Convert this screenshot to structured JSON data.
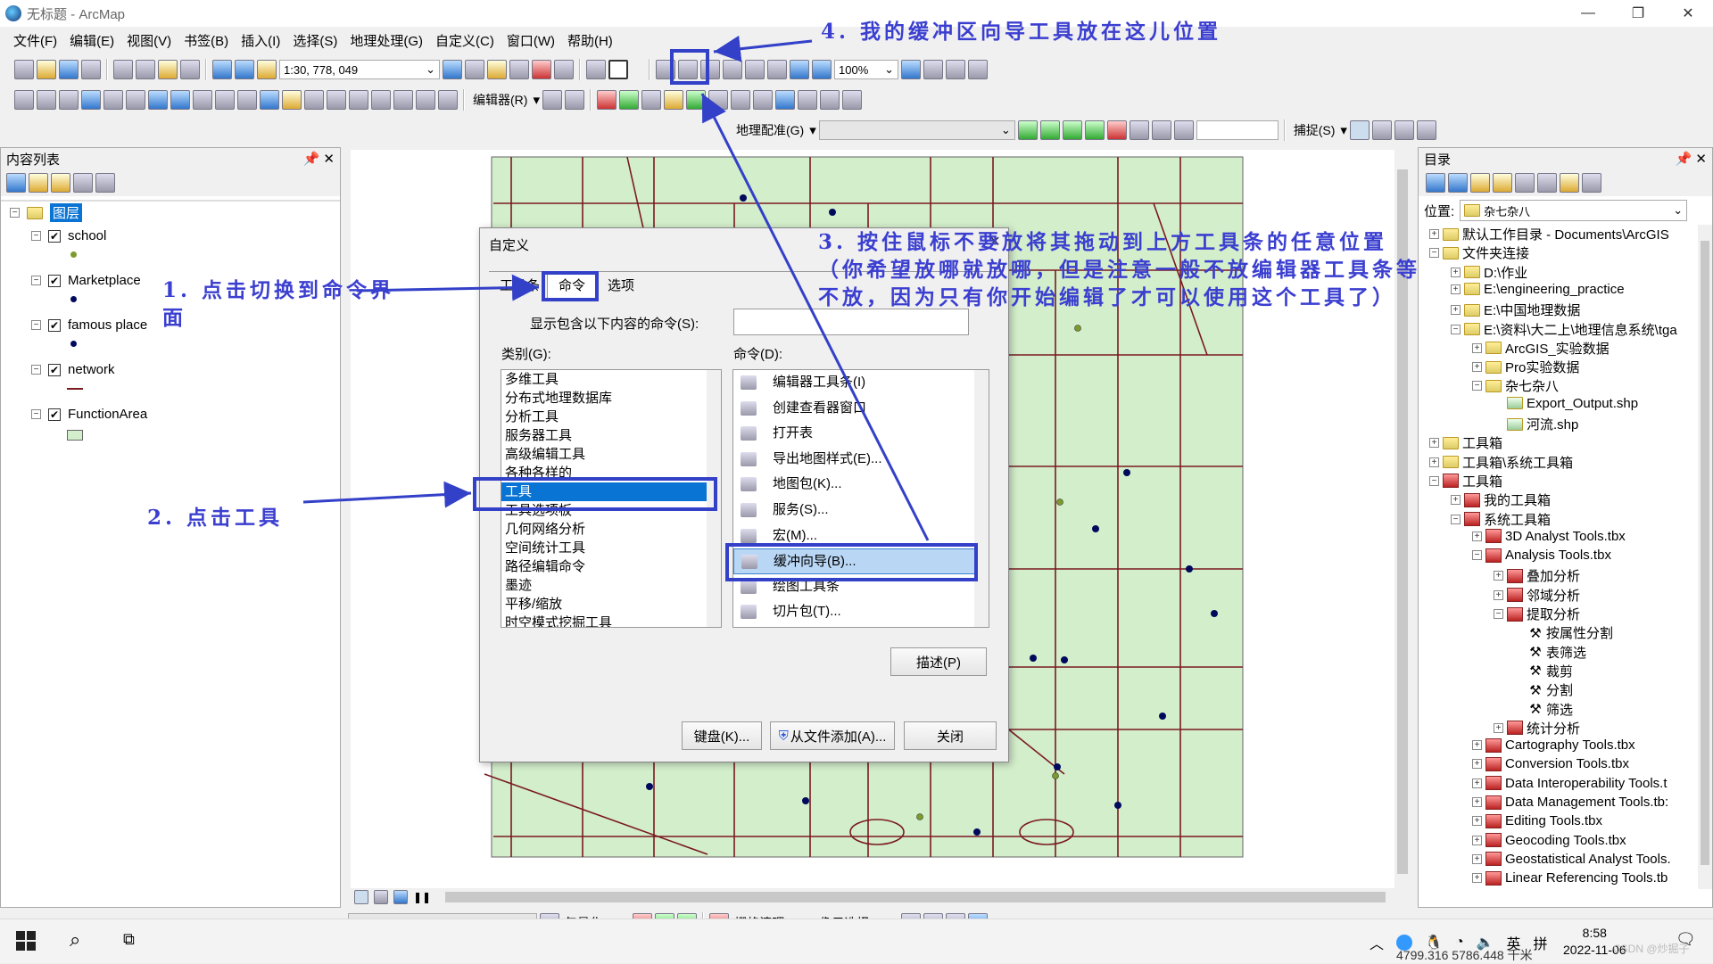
{
  "window": {
    "title": "无标题 - ArcMap"
  },
  "menu": [
    "文件(F)",
    "编辑(E)",
    "视图(V)",
    "书签(B)",
    "插入(I)",
    "选择(S)",
    "地理处理(G)",
    "自定义(C)",
    "窗口(W)",
    "帮助(H)"
  ],
  "toolbar": {
    "scale": "1:30, 778, 049",
    "zoom": "100%",
    "editor": "编辑器(R)",
    "georef": "地理配准(G)",
    "snap": "捕捉(S)"
  },
  "toc": {
    "title": "内容列表",
    "root": "图层",
    "layers": [
      {
        "name": "school",
        "symbol": "point-olive"
      },
      {
        "name": "Marketplace",
        "symbol": "point-navy"
      },
      {
        "name": "famous place",
        "symbol": "point-navy"
      },
      {
        "name": "network",
        "symbol": "line-darkred"
      },
      {
        "name": "FunctionArea",
        "symbol": "polygon-lightgreen"
      }
    ]
  },
  "dialog": {
    "title": "自定义",
    "tabs": [
      "工具条",
      "命令",
      "选项"
    ],
    "filter_label": "显示包含以下内容的命令(S):",
    "categories_label": "类别(G):",
    "commands_label": "命令(D):",
    "categories": [
      "多维工具",
      "分布式地理数据库",
      "分析工具",
      "服务器工具",
      "高级编辑工具",
      "各种各样的",
      "工具",
      "工具选项板",
      "几何网络分析",
      "空间统计工具",
      "路径编辑命令",
      "墨迹",
      "平移/缩放",
      "时空模式挖掘工具"
    ],
    "selected_category": "工具",
    "commands": [
      "编辑器工具条(I)",
      "创建查看器窗口",
      "打开表",
      "导出地图样式(E)...",
      "地图包(K)...",
      "服务(S)...",
      "宏(M)...",
      "缓冲向导(B)...",
      "绘图工具条",
      "切片包(T)..."
    ],
    "selected_command": "缓冲向导(B)...",
    "describe": "描述(P)",
    "keyboard": "键盘(K)...",
    "add_from_file": "从文件添加(A)...",
    "close": "关闭"
  },
  "annotations": {
    "a1": "1. 点击切换到命令界面",
    "a2": "2. 点击工具",
    "a3": "3. 按住鼠标不要放将其拖动到上方工具条的任意位置（你希望放哪就放哪，但是注意一般不放编辑器工具条等不放，因为只有你开始编辑了才可以使用这个工具了）",
    "a4": "4. 我的缓冲区向导工具放在这儿位置"
  },
  "catalog": {
    "title": "目录",
    "location_label": "位置:",
    "location": "杂七杂八",
    "items": [
      {
        "level": 0,
        "text": "默认工作目录 - Documents\\ArcGIS",
        "kind": "folder",
        "exp": "+"
      },
      {
        "level": 0,
        "text": "文件夹连接",
        "kind": "folder",
        "exp": "-"
      },
      {
        "level": 1,
        "text": "D:\\作业",
        "kind": "folder",
        "exp": "+"
      },
      {
        "level": 1,
        "text": "E:\\engineering_practice",
        "kind": "folder",
        "exp": "+"
      },
      {
        "level": 1,
        "text": "E:\\中国地理数据",
        "kind": "folder",
        "exp": "+"
      },
      {
        "level": 1,
        "text": "E:\\资料\\大二上\\地理信息系统\\tga",
        "kind": "folder",
        "exp": "-"
      },
      {
        "level": 2,
        "text": "ArcGIS_实验数据",
        "kind": "folder",
        "exp": "+"
      },
      {
        "level": 2,
        "text": "Pro实验数据",
        "kind": "folder",
        "exp": "+"
      },
      {
        "level": 2,
        "text": "杂七杂八",
        "kind": "folder",
        "exp": "-"
      },
      {
        "level": 3,
        "text": "Export_Output.shp",
        "kind": "shp",
        "exp": ""
      },
      {
        "level": 3,
        "text": "河流.shp",
        "kind": "shp",
        "exp": ""
      },
      {
        "level": 0,
        "text": "工具箱",
        "kind": "folder",
        "exp": "+"
      },
      {
        "level": 0,
        "text": "工具箱\\系统工具箱",
        "kind": "folder",
        "exp": "+"
      },
      {
        "level": 0,
        "text": "工具箱",
        "kind": "tbx",
        "exp": "-"
      },
      {
        "level": 1,
        "text": "我的工具箱",
        "kind": "tbx",
        "exp": "+"
      },
      {
        "level": 1,
        "text": "系统工具箱",
        "kind": "tbx",
        "exp": "-"
      },
      {
        "level": 2,
        "text": "3D Analyst Tools.tbx",
        "kind": "tbx",
        "exp": "+"
      },
      {
        "level": 2,
        "text": "Analysis Tools.tbx",
        "kind": "tbx",
        "exp": "-"
      },
      {
        "level": 3,
        "text": "叠加分析",
        "kind": "tbx",
        "exp": "+"
      },
      {
        "level": 3,
        "text": "邻域分析",
        "kind": "tbx",
        "exp": "+"
      },
      {
        "level": 3,
        "text": "提取分析",
        "kind": "tbx",
        "exp": "-"
      },
      {
        "level": 4,
        "text": "按属性分割",
        "kind": "tool",
        "exp": ""
      },
      {
        "level": 4,
        "text": "表筛选",
        "kind": "tool",
        "exp": ""
      },
      {
        "level": 4,
        "text": "裁剪",
        "kind": "tool",
        "exp": ""
      },
      {
        "level": 4,
        "text": "分割",
        "kind": "tool",
        "exp": ""
      },
      {
        "level": 4,
        "text": "筛选",
        "kind": "tool",
        "exp": ""
      },
      {
        "level": 3,
        "text": "统计分析",
        "kind": "tbx",
        "exp": "+"
      },
      {
        "level": 2,
        "text": "Cartography Tools.tbx",
        "kind": "tbx",
        "exp": "+"
      },
      {
        "level": 2,
        "text": "Conversion Tools.tbx",
        "kind": "tbx",
        "exp": "+"
      },
      {
        "level": 2,
        "text": "Data Interoperability Tools.t",
        "kind": "tbx",
        "exp": "+"
      },
      {
        "level": 2,
        "text": "Data Management Tools.tb:",
        "kind": "tbx",
        "exp": "+"
      },
      {
        "level": 2,
        "text": "Editing Tools.tbx",
        "kind": "tbx",
        "exp": "+"
      },
      {
        "level": 2,
        "text": "Geocoding Tools.tbx",
        "kind": "tbx",
        "exp": "+"
      },
      {
        "level": 2,
        "text": "Geostatistical Analyst Tools.",
        "kind": "tbx",
        "exp": "+"
      },
      {
        "level": 2,
        "text": "Linear Referencing Tools.tb",
        "kind": "tbx",
        "exp": "+"
      }
    ]
  },
  "bottombar": {
    "vectorize": "矢量化(Z)",
    "raster_clean": "栅格清理(C)",
    "cell_select": "像元选择(N)"
  },
  "status": {
    "coords": "4799.316  5786.448 千米"
  },
  "taskbar": {
    "ime": "英",
    "time": "8:58",
    "date": "2022-11-06",
    "watermark": "CSDN @炒掘子"
  },
  "colors": {
    "map_bg": "#d3eecb",
    "road": "#7a1a20",
    "annotation": "#3b3fd0",
    "selection": "#0a74d4"
  }
}
